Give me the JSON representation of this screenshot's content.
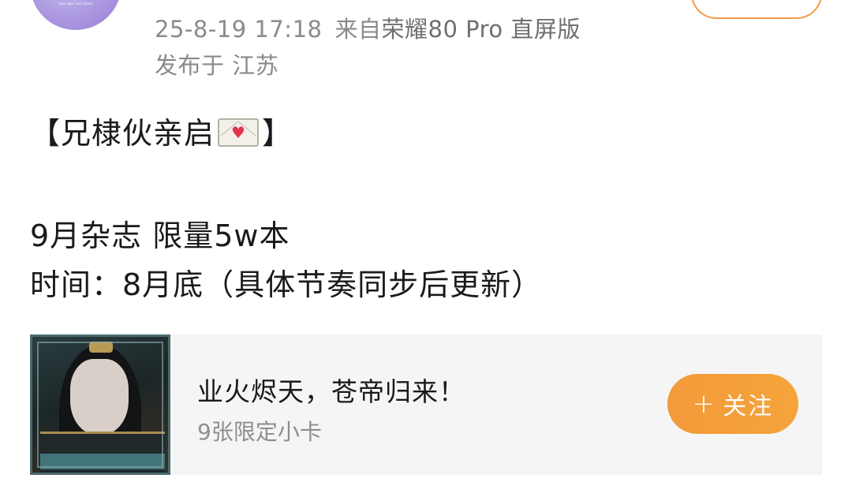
{
  "header": {
    "avatar_text": "but you are my moon and my sun and my stars",
    "timestamp": "25-8-19 17:18",
    "source_prefix": "来自",
    "device": "荣耀80 Pro 直屏版",
    "location": "发布于 江苏"
  },
  "post": {
    "line1_open": "【兄棣伙亲启",
    "line1_emoji": "envelope-with-heart-icon",
    "line1_close": "】",
    "line2": "9月杂志  限量5w本",
    "line3": "时间：8月底（具体节奏同步后更新）"
  },
  "card": {
    "title": "业火烬天，苍帝归来！",
    "subtitle": "9张限定小卡",
    "follow_plus": "+",
    "follow_label": "关注",
    "accent_color": "#f39a3a"
  }
}
